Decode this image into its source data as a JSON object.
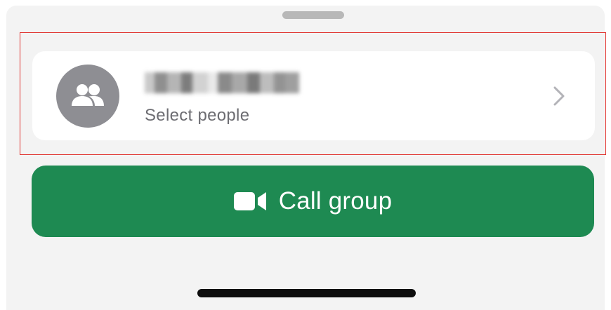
{
  "group_row": {
    "name": "",
    "subtitle": "Select people",
    "avatar_icon": "group-people-icon",
    "chevron_icon": "chevron-right-icon"
  },
  "call_button": {
    "label": "Call group",
    "icon": "video-camera-icon"
  },
  "colors": {
    "sheet_background": "#f3f3f3",
    "card_background": "#ffffff",
    "accent_green": "#1e8a52",
    "highlight_red": "#e0312c",
    "avatar_gray": "#8e8e93"
  }
}
